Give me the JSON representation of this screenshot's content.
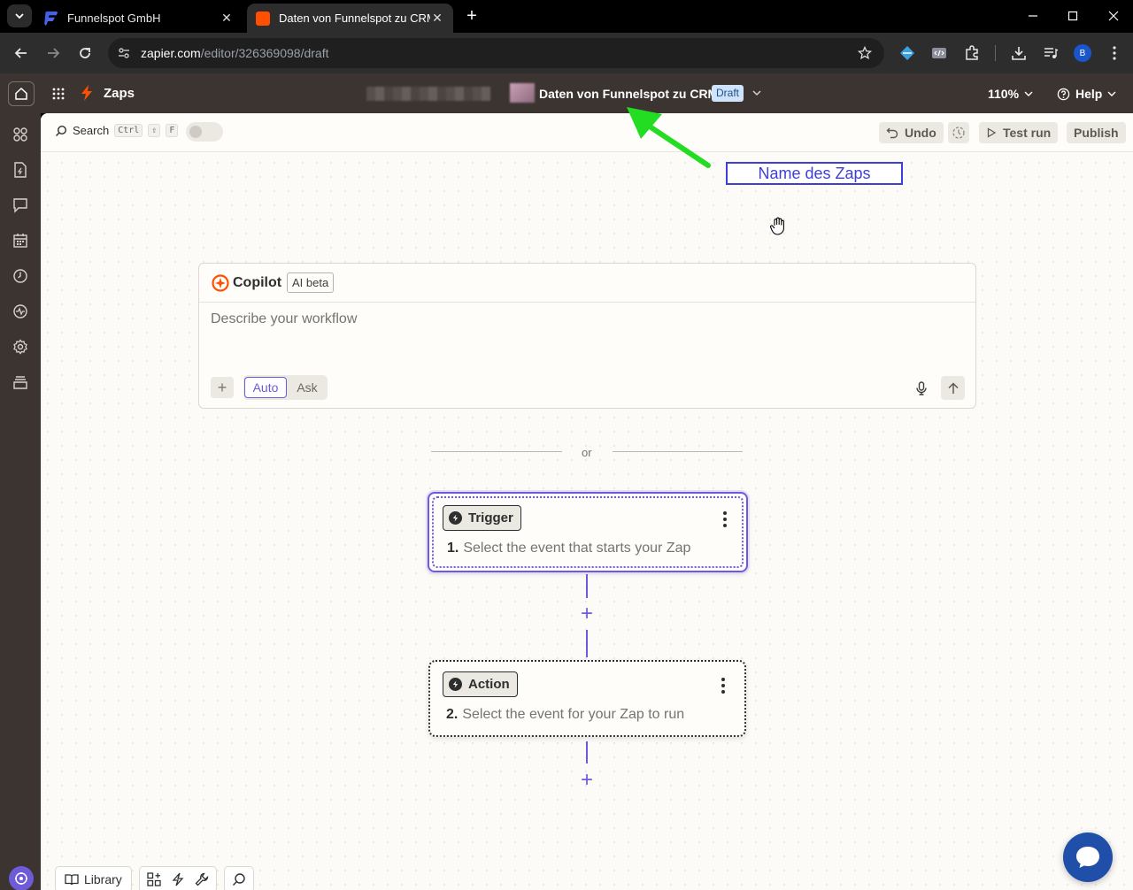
{
  "browser": {
    "tabs": [
      {
        "title": "Funnelspot GmbH",
        "close": "✕"
      },
      {
        "title": "Daten von Funnelspot zu CRM |",
        "close": "✕"
      }
    ],
    "new_tab": "+",
    "url_host": "zapier.com",
    "url_path": "/editor/326369098/draft",
    "profile_initial": "B"
  },
  "app": {
    "section": "Zaps",
    "zap_name": "Daten von Funnelspot zu CRM",
    "status_badge": "Draft",
    "zoom": "110%",
    "help": "Help"
  },
  "subbar": {
    "search_label": "Search",
    "shortcut_ctrl": "Ctrl",
    "shortcut_shift": "⇧",
    "shortcut_f": "F",
    "undo": "Undo",
    "test_run": "Test run",
    "publish": "Publish"
  },
  "annotation": {
    "label": "Name des Zaps",
    "arrow_color": "#22dd22"
  },
  "copilot": {
    "title": "Copilot",
    "badge": "AI beta",
    "placeholder": "Describe your workflow",
    "mode_auto": "Auto",
    "mode_ask": "Ask",
    "add": "+"
  },
  "divider": "or",
  "steps": [
    {
      "type": "Trigger",
      "number": "1.",
      "description": "Select the event that starts your Zap"
    },
    {
      "type": "Action",
      "number": "2.",
      "description": "Select the event for your Zap to run"
    }
  ],
  "bottom": {
    "library": "Library"
  },
  "colors": {
    "brand_orange": "#ff4f00",
    "accent_purple": "#6f5ad8",
    "header_bg": "#3c3431"
  },
  "icons": [
    "home-icon",
    "apps-grid-icon",
    "zap-bolt-icon",
    "search-icon",
    "undo-icon",
    "play-icon",
    "mic-icon",
    "send-arrow-icon",
    "chat-bubble-icon",
    "library-book-icon"
  ]
}
